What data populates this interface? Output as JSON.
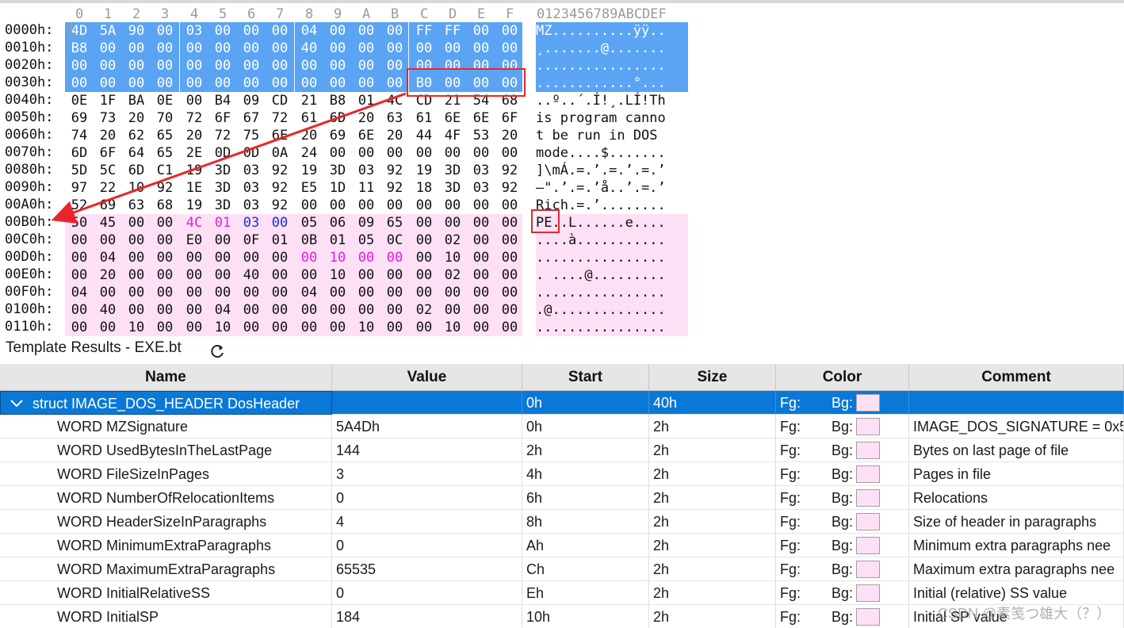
{
  "hex_view": {
    "column_headers": [
      "0",
      "1",
      "2",
      "3",
      "4",
      "5",
      "6",
      "7",
      "8",
      "9",
      "A",
      "B",
      "C",
      "D",
      "E",
      "F"
    ],
    "ascii_header": "0123456789ABCDEF",
    "rows": [
      {
        "addr": "0000h:",
        "bytes": [
          "4D",
          "5A",
          "90",
          "00",
          "03",
          "00",
          "00",
          "00",
          "04",
          "00",
          "00",
          "00",
          "FF",
          "FF",
          "00",
          "00"
        ],
        "ascii": "MZ..........ÿÿ.."
      },
      {
        "addr": "0010h:",
        "bytes": [
          "B8",
          "00",
          "00",
          "00",
          "00",
          "00",
          "00",
          "00",
          "40",
          "00",
          "00",
          "00",
          "00",
          "00",
          "00",
          "00"
        ],
        "ascii": "¸.......@......."
      },
      {
        "addr": "0020h:",
        "bytes": [
          "00",
          "00",
          "00",
          "00",
          "00",
          "00",
          "00",
          "00",
          "00",
          "00",
          "00",
          "00",
          "00",
          "00",
          "00",
          "00"
        ],
        "ascii": "................"
      },
      {
        "addr": "0030h:",
        "bytes": [
          "00",
          "00",
          "00",
          "00",
          "00",
          "00",
          "00",
          "00",
          "00",
          "00",
          "00",
          "00",
          "B0",
          "00",
          "00",
          "00"
        ],
        "ascii": "............°..."
      },
      {
        "addr": "0040h:",
        "bytes": [
          "0E",
          "1F",
          "BA",
          "0E",
          "00",
          "B4",
          "09",
          "CD",
          "21",
          "B8",
          "01",
          "4C",
          "CD",
          "21",
          "54",
          "68"
        ],
        "ascii": "..º..´.Í!¸.LÍ!Th"
      },
      {
        "addr": "0050h:",
        "bytes": [
          "69",
          "73",
          "20",
          "70",
          "72",
          "6F",
          "67",
          "72",
          "61",
          "6D",
          "20",
          "63",
          "61",
          "6E",
          "6E",
          "6F"
        ],
        "ascii": "is program canno"
      },
      {
        "addr": "0060h:",
        "bytes": [
          "74",
          "20",
          "62",
          "65",
          "20",
          "72",
          "75",
          "6E",
          "20",
          "69",
          "6E",
          "20",
          "44",
          "4F",
          "53",
          "20"
        ],
        "ascii": "t be run in DOS "
      },
      {
        "addr": "0070h:",
        "bytes": [
          "6D",
          "6F",
          "64",
          "65",
          "2E",
          "0D",
          "0D",
          "0A",
          "24",
          "00",
          "00",
          "00",
          "00",
          "00",
          "00",
          "00"
        ],
        "ascii": "mode....$......."
      },
      {
        "addr": "0080h:",
        "bytes": [
          "5D",
          "5C",
          "6D",
          "C1",
          "19",
          "3D",
          "03",
          "92",
          "19",
          "3D",
          "03",
          "92",
          "19",
          "3D",
          "03",
          "92"
        ],
        "ascii": "]\\mÁ.=.’.=.’.=.’"
      },
      {
        "addr": "0090h:",
        "bytes": [
          "97",
          "22",
          "10",
          "92",
          "1E",
          "3D",
          "03",
          "92",
          "E5",
          "1D",
          "11",
          "92",
          "18",
          "3D",
          "03",
          "92"
        ],
        "ascii": "—\".’.=.’å..’.=.’"
      },
      {
        "addr": "00A0h:",
        "bytes": [
          "52",
          "69",
          "63",
          "68",
          "19",
          "3D",
          "03",
          "92",
          "00",
          "00",
          "00",
          "00",
          "00",
          "00",
          "00",
          "00"
        ],
        "ascii": "Rich.=.’........"
      },
      {
        "addr": "00B0h:",
        "bytes": [
          "50",
          "45",
          "00",
          "00",
          "4C",
          "01",
          "03",
          "00",
          "05",
          "06",
          "09",
          "65",
          "00",
          "00",
          "00",
          "00"
        ],
        "ascii": "PE..L......e...."
      },
      {
        "addr": "00C0h:",
        "bytes": [
          "00",
          "00",
          "00",
          "00",
          "E0",
          "00",
          "0F",
          "01",
          "0B",
          "01",
          "05",
          "0C",
          "00",
          "02",
          "00",
          "00"
        ],
        "ascii": "....à..........."
      },
      {
        "addr": "00D0h:",
        "bytes": [
          "00",
          "04",
          "00",
          "00",
          "00",
          "00",
          "00",
          "00",
          "00",
          "10",
          "00",
          "00",
          "00",
          "10",
          "00",
          "00"
        ],
        "ascii": "................"
      },
      {
        "addr": "00E0h:",
        "bytes": [
          "00",
          "20",
          "00",
          "00",
          "00",
          "00",
          "40",
          "00",
          "00",
          "10",
          "00",
          "00",
          "00",
          "02",
          "00",
          "00"
        ],
        "ascii": ". ....@........."
      },
      {
        "addr": "00F0h:",
        "bytes": [
          "04",
          "00",
          "00",
          "00",
          "00",
          "00",
          "00",
          "00",
          "04",
          "00",
          "00",
          "00",
          "00",
          "00",
          "00",
          "00"
        ],
        "ascii": "................"
      },
      {
        "addr": "0100h:",
        "bytes": [
          "00",
          "40",
          "00",
          "00",
          "00",
          "04",
          "00",
          "00",
          "00",
          "00",
          "00",
          "00",
          "02",
          "00",
          "00",
          "00"
        ],
        "ascii": ".@.............."
      },
      {
        "addr": "0110h:",
        "bytes": [
          "00",
          "00",
          "10",
          "00",
          "00",
          "10",
          "00",
          "00",
          "00",
          "00",
          "10",
          "00",
          "00",
          "10",
          "00",
          "00"
        ],
        "ascii": "................"
      }
    ],
    "colors": {
      "selected_bg": "#5ba4f4",
      "pe_bg": "#fde0f6",
      "pe_mark": "#e020e0",
      "pe_mark_blue": "#1030e0",
      "annotation_red": "#e8262a"
    }
  },
  "template": {
    "title": "Template Results - EXE.bt",
    "refresh_icon": "refresh-icon",
    "columns": [
      "Name",
      "Value",
      "Start",
      "Size",
      "Color",
      "Comment"
    ],
    "rows": [
      {
        "name": "struct IMAGE_DOS_HEADER DosHeader",
        "value": "",
        "start": "0h",
        "size": "40h",
        "fg": "Fg:",
        "bg": "Bg:",
        "comment": "",
        "selected": true
      },
      {
        "name": "WORD MZSignature",
        "value": "5A4Dh",
        "start": "0h",
        "size": "2h",
        "fg": "Fg:",
        "bg": "Bg:",
        "comment": "IMAGE_DOS_SIGNATURE = 0x5"
      },
      {
        "name": "WORD UsedBytesInTheLastPage",
        "value": "144",
        "start": "2h",
        "size": "2h",
        "fg": "Fg:",
        "bg": "Bg:",
        "comment": "Bytes on last page of file"
      },
      {
        "name": "WORD FileSizeInPages",
        "value": "3",
        "start": "4h",
        "size": "2h",
        "fg": "Fg:",
        "bg": "Bg:",
        "comment": "Pages in file"
      },
      {
        "name": "WORD NumberOfRelocationItems",
        "value": "0",
        "start": "6h",
        "size": "2h",
        "fg": "Fg:",
        "bg": "Bg:",
        "comment": "Relocations"
      },
      {
        "name": "WORD HeaderSizeInParagraphs",
        "value": "4",
        "start": "8h",
        "size": "2h",
        "fg": "Fg:",
        "bg": "Bg:",
        "comment": "Size of header in paragraphs"
      },
      {
        "name": "WORD MinimumExtraParagraphs",
        "value": "0",
        "start": "Ah",
        "size": "2h",
        "fg": "Fg:",
        "bg": "Bg:",
        "comment": "Minimum extra paragraphs nee"
      },
      {
        "name": "WORD MaximumExtraParagraphs",
        "value": "65535",
        "start": "Ch",
        "size": "2h",
        "fg": "Fg:",
        "bg": "Bg:",
        "comment": "Maximum extra paragraphs nee"
      },
      {
        "name": "WORD InitialRelativeSS",
        "value": "0",
        "start": "Eh",
        "size": "2h",
        "fg": "Fg:",
        "bg": "Bg:",
        "comment": "Initial (relative) SS value"
      },
      {
        "name": "WORD InitialSP",
        "value": "184",
        "start": "10h",
        "size": "2h",
        "fg": "Fg:",
        "bg": "Bg:",
        "comment": "Initial SP value"
      }
    ]
  },
  "watermark": "CSDN @素笺つ雄大（？）"
}
